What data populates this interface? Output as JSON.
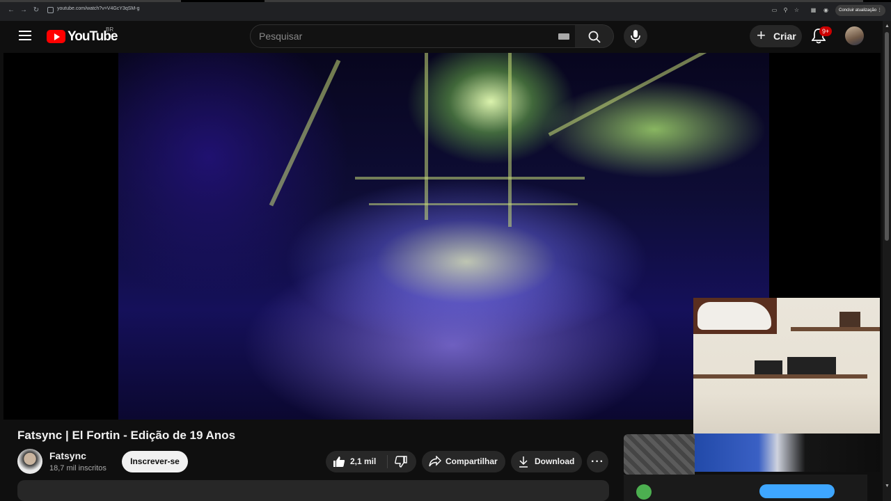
{
  "browser": {
    "url": "youtube.com/watch?v=V4GcY3qSM-g",
    "update_label": "Concluir atualização"
  },
  "masthead": {
    "logo_text": "YouTube",
    "country_code": "BR",
    "search_placeholder": "Pesquisar",
    "create_label": "Criar",
    "notification_count": "9+"
  },
  "video": {
    "title": "Fatsync | El Fortin - Edição de 19 Anos"
  },
  "channel": {
    "name": "Fatsync",
    "subscribers": "18,7 mil inscritos",
    "subscribe_label": "Inscrever-se"
  },
  "actions": {
    "likes": "2,1 mil",
    "share_label": "Compartilhar",
    "download_label": "Download",
    "more_label": "···"
  },
  "colors": {
    "background": "#0f0f0f",
    "brand_red": "#ff0000",
    "pill": "#272727",
    "subscribe_bg": "#f1f1f1",
    "badge": "#cc0000"
  }
}
